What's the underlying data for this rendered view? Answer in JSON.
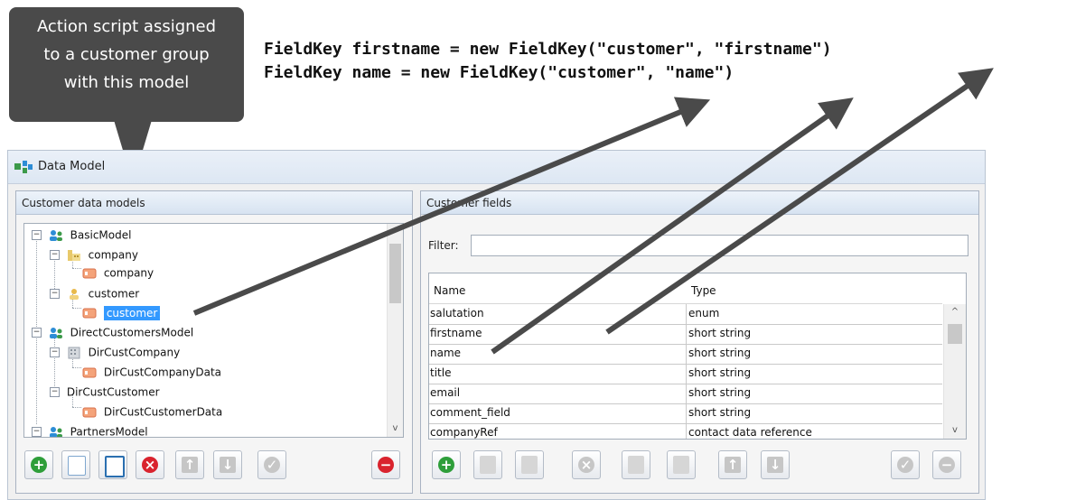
{
  "callout": {
    "line1": "Action script assigned",
    "line2": "to a customer group",
    "line3": "with this model"
  },
  "code": {
    "line1": "FieldKey firstname = new FieldKey(\"customer\", \"firstname\")",
    "line2": "FieldKey name = new FieldKey(\"customer\", \"name\")"
  },
  "window": {
    "title": "Data Model"
  },
  "left_panel": {
    "title": "Customer data models",
    "tree": [
      {
        "label": "BasicModel",
        "icon": "group-icon"
      },
      {
        "label": "company",
        "icon": "building-icon"
      },
      {
        "label": "company",
        "icon": "record-icon"
      },
      {
        "label": "customer",
        "icon": "person-icon"
      },
      {
        "label": "customer",
        "icon": "record-icon",
        "selected": true
      },
      {
        "label": "DirectCustomersModel",
        "icon": "group-icon"
      },
      {
        "label": "DirCustCompany",
        "icon": "building-icon"
      },
      {
        "label": "DirCustCompanyData",
        "icon": "record-icon"
      },
      {
        "label": "DirCustCustomer",
        "icon": ""
      },
      {
        "label": "DirCustCustomerData",
        "icon": "record-icon"
      },
      {
        "label": "PartnersModel",
        "icon": "group-icon"
      }
    ]
  },
  "right_panel": {
    "title": "Customer fields",
    "filter_label": "Filter:",
    "filter_value": "",
    "columns": [
      "Name",
      "Type"
    ],
    "rows": [
      [
        "salutation",
        "enum"
      ],
      [
        "firstname",
        "short string"
      ],
      [
        "name",
        "short string"
      ],
      [
        "title",
        "short string"
      ],
      [
        "email",
        "short string"
      ],
      [
        "comment_field",
        "short string"
      ],
      [
        "companyRef",
        "contact data reference"
      ]
    ]
  },
  "colors": {
    "callout_bg": "#4a4a4a",
    "selection": "#3399ff",
    "add_green": "#2e9e3a",
    "delete_red": "#d9232e",
    "arrow": "#4a4a4a"
  }
}
